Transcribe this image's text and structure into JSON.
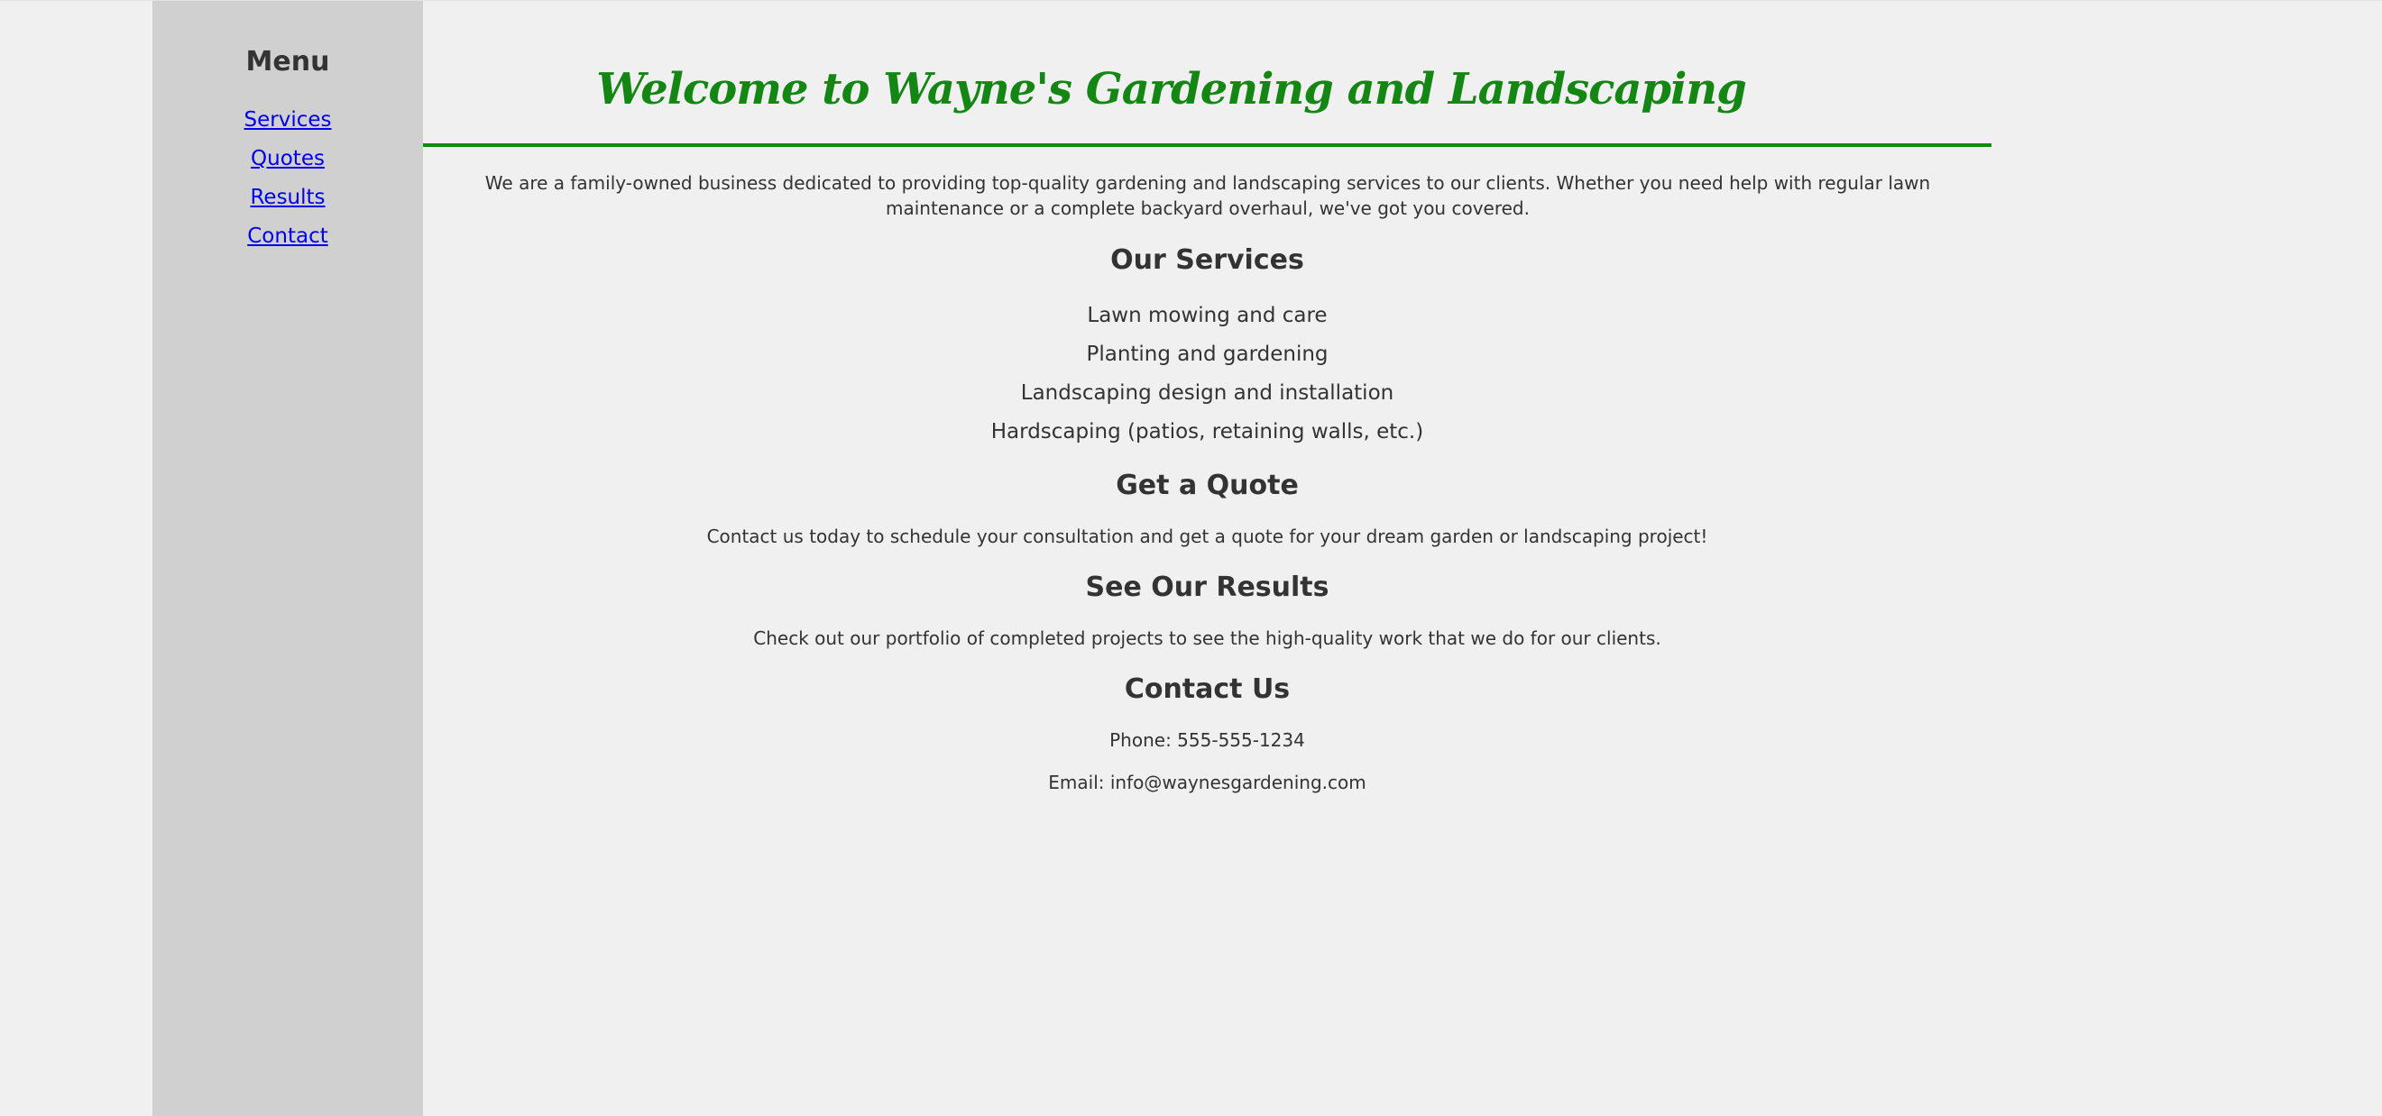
{
  "sidebar": {
    "heading": "Menu",
    "items": [
      {
        "label": "Services"
      },
      {
        "label": "Quotes"
      },
      {
        "label": "Results"
      },
      {
        "label": "Contact"
      }
    ]
  },
  "header": {
    "title": "Welcome to Wayne's Gardening and Landscaping"
  },
  "intro": "We are a family-owned business dedicated to providing top-quality gardening and landscaping services to our clients. Whether you need help with regular lawn maintenance or a complete backyard overhaul, we've got you covered.",
  "services": {
    "title": "Our Services",
    "items": [
      "Lawn mowing and care",
      "Planting and gardening",
      "Landscaping design and installation",
      "Hardscaping (patios, retaining walls, etc.)"
    ]
  },
  "quote": {
    "title": "Get a Quote",
    "text": "Contact us today to schedule your consultation and get a quote for your dream garden or landscaping project!"
  },
  "results": {
    "title": "See Our Results",
    "text": "Check out our portfolio of completed projects to see the high-quality work that we do for our clients."
  },
  "contact": {
    "title": "Contact Us",
    "phone": "Phone: 555-555-1234",
    "email": "Email: info@waynesgardening.com"
  },
  "colors": {
    "accent": "#148614",
    "sidebar_bg": "#d0d0d0",
    "page_bg": "#f0f0f0",
    "link": "#0000ee"
  }
}
